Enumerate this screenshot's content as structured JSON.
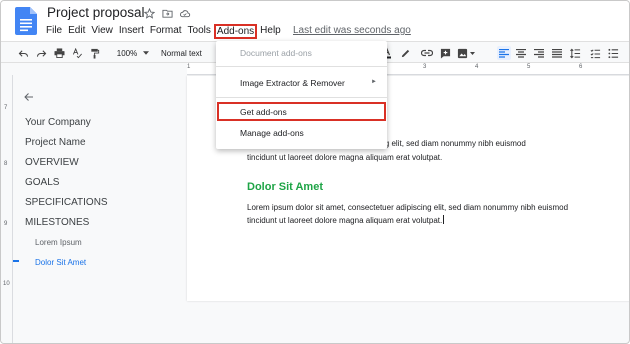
{
  "header": {
    "title": "Project proposal",
    "last_edit": "Last edit was seconds ago",
    "icons": [
      "star-icon",
      "move-to-folder-icon",
      "cloud-status-icon"
    ]
  },
  "menu": {
    "file": "File",
    "edit": "Edit",
    "view": "View",
    "insert": "Insert",
    "format": "Format",
    "tools": "Tools",
    "addons": "Add-ons",
    "help": "Help"
  },
  "toolbar": {
    "zoom": "100%",
    "style": "Normal text"
  },
  "ruler": {
    "h_numbers": [
      "1",
      "2",
      "3",
      "4",
      "5",
      "6"
    ],
    "v_numbers": [
      "7",
      "8",
      "9",
      "10"
    ]
  },
  "outline": {
    "items": [
      "Your Company",
      "Project Name",
      "OVERVIEW",
      "GOALS",
      "SPECIFICATIONS",
      "MILESTONES"
    ],
    "sub_items": [
      "Lorem Ipsum",
      "Dolor Sit Amet"
    ]
  },
  "document": {
    "para1_line1": "ctetuer adipiscing elit, sed diam nonummy nibh euismod",
    "para1_line2": "tincidunt ut laoreet dolore magna aliquam erat volutpat.",
    "heading2": "Dolor Sit Amet",
    "para2_line1": "Lorem ipsum dolor sit amet, consectetuer adipiscing elit, sed diam nonummy nibh euismod",
    "para2_line2": "tincidunt ut laoreet dolore magna aliquam erat volutpat."
  },
  "dropdown": {
    "document_addons": "Document add-ons",
    "image_extractor": "Image Extractor & Remover",
    "submenu_arrow": "►",
    "get_addons": "Get add-ons",
    "manage_addons": "Manage add-ons"
  },
  "colors": {
    "highlight_border": "#d93025",
    "heading_green": "#1ea446",
    "accent_blue": "#1a73e8"
  }
}
